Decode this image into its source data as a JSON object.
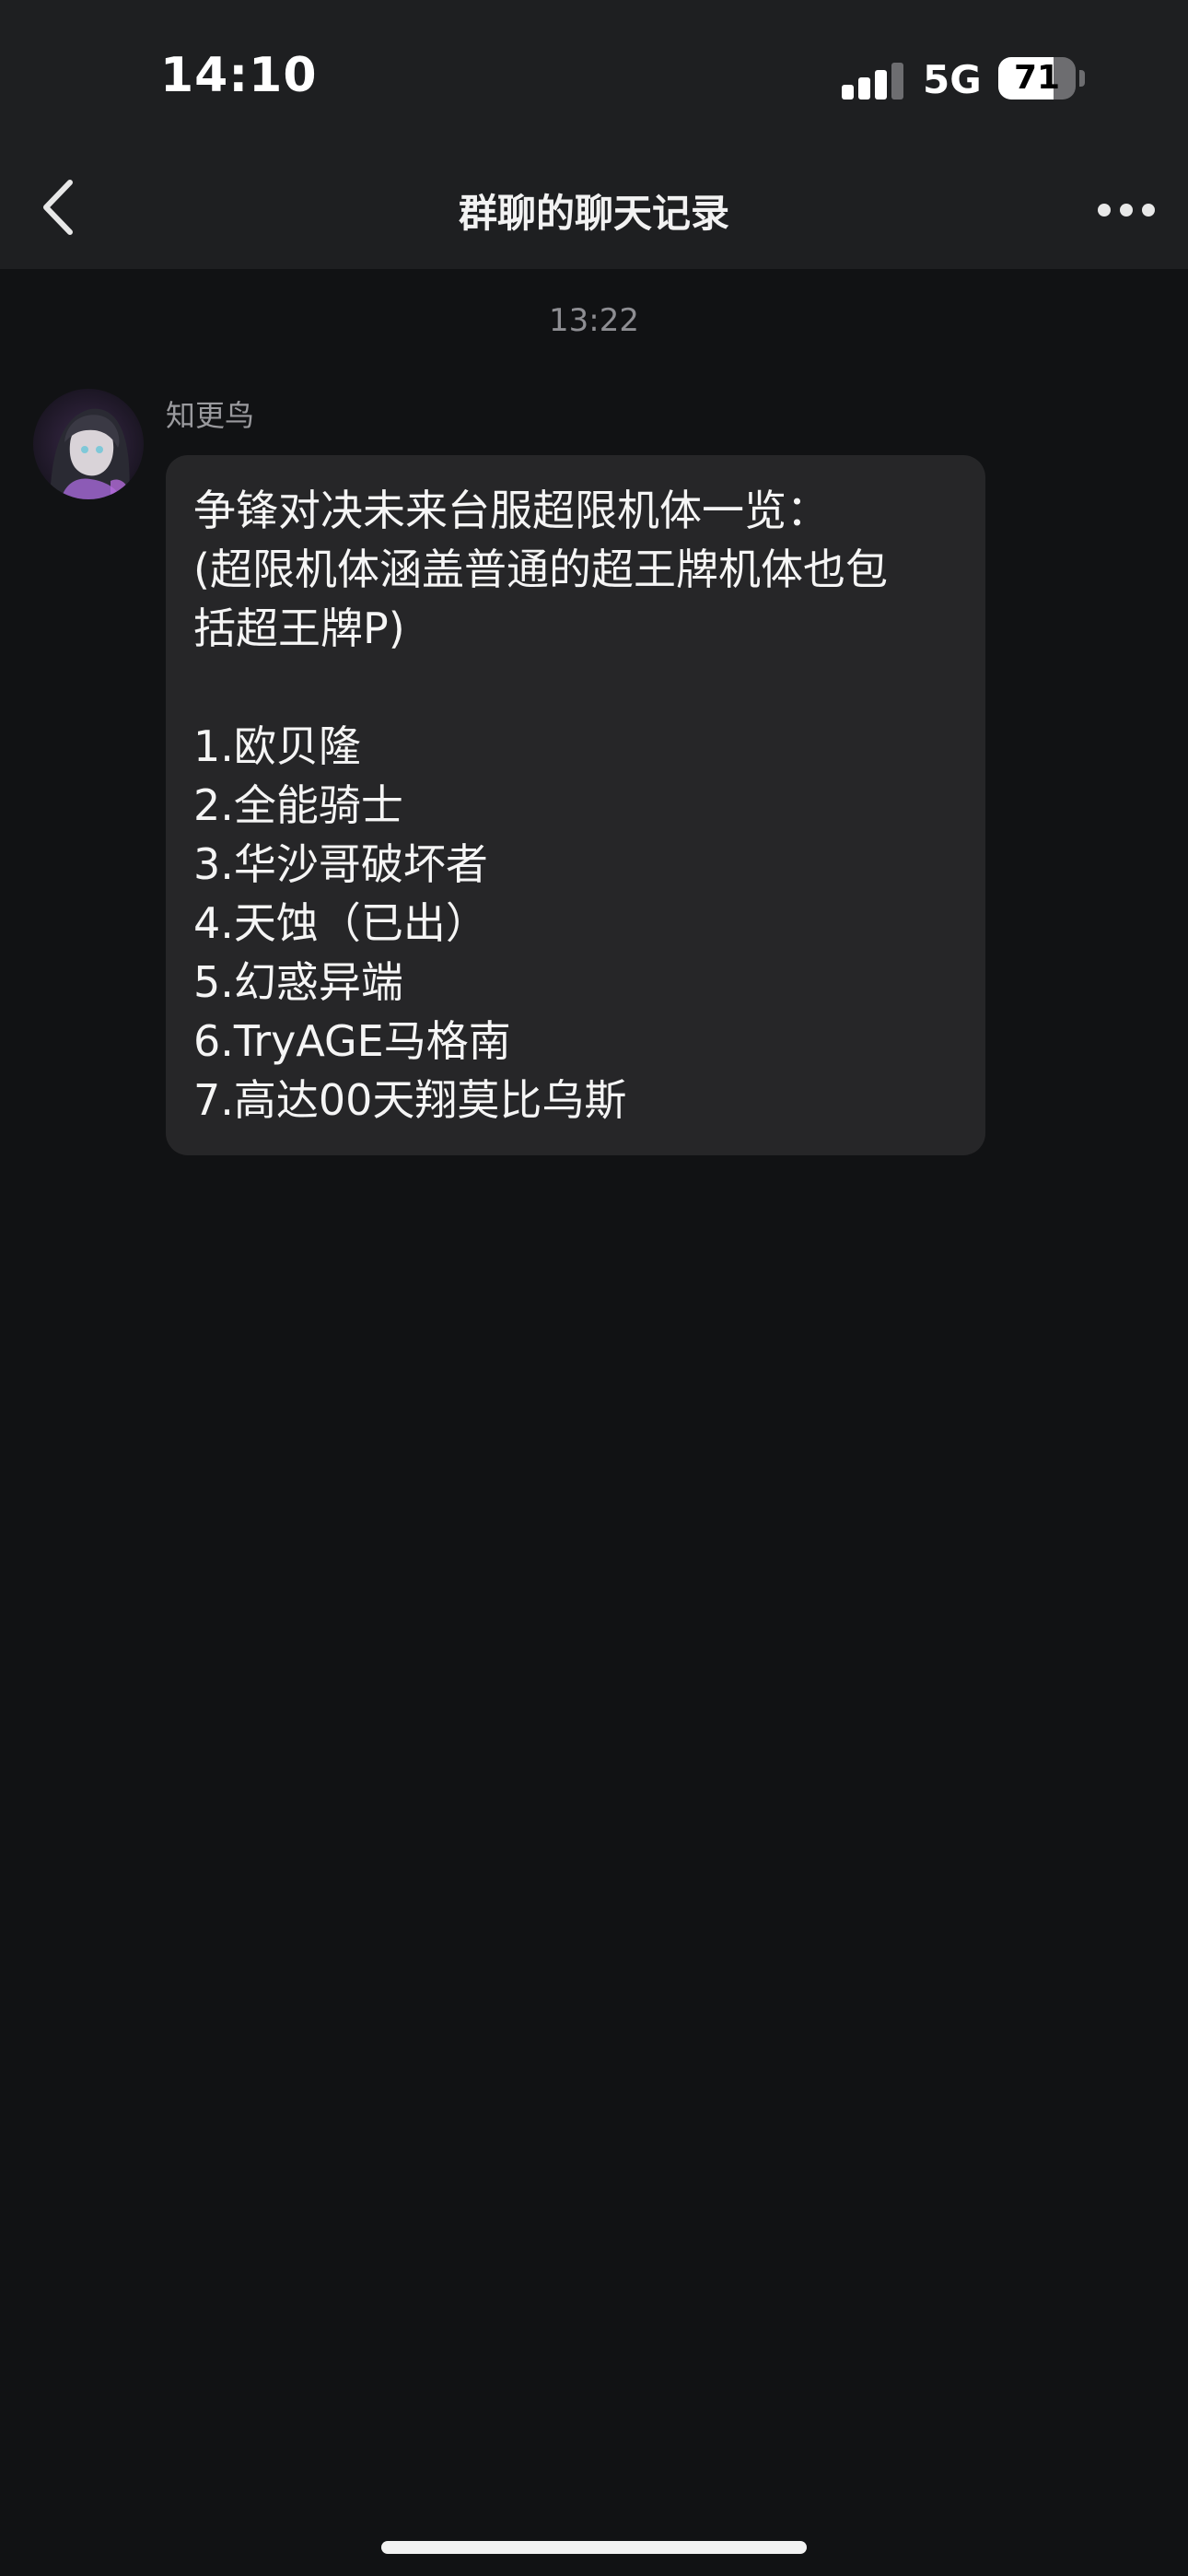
{
  "status_bar": {
    "time": "14:10",
    "network": "5G",
    "battery_level": "71",
    "battery_fraction": 0.71
  },
  "nav": {
    "back_icon": "chevron-left-icon",
    "title": "群聊的聊天记录",
    "more_icon": "ellipsis-icon"
  },
  "chat": {
    "timestamp": "13:22",
    "message": {
      "sender": "知更鸟",
      "lines": [
        "争锋对决未来台服超限机体一览：",
        "(超限机体涵盖普通的超王牌机体也包",
        "括超王牌P)",
        "",
        "1.欧贝隆",
        "2.全能骑士",
        "3.华沙哥破坏者",
        "4.天蚀（已出）",
        "5.幻惑异端",
        "6.TryAGE马格南",
        "7.高达00天翔莫比乌斯"
      ]
    }
  },
  "colors": {
    "background": "#111214",
    "nav_background": "#1e1f21",
    "bubble": "#262628",
    "muted_text": "#8e8e93"
  }
}
